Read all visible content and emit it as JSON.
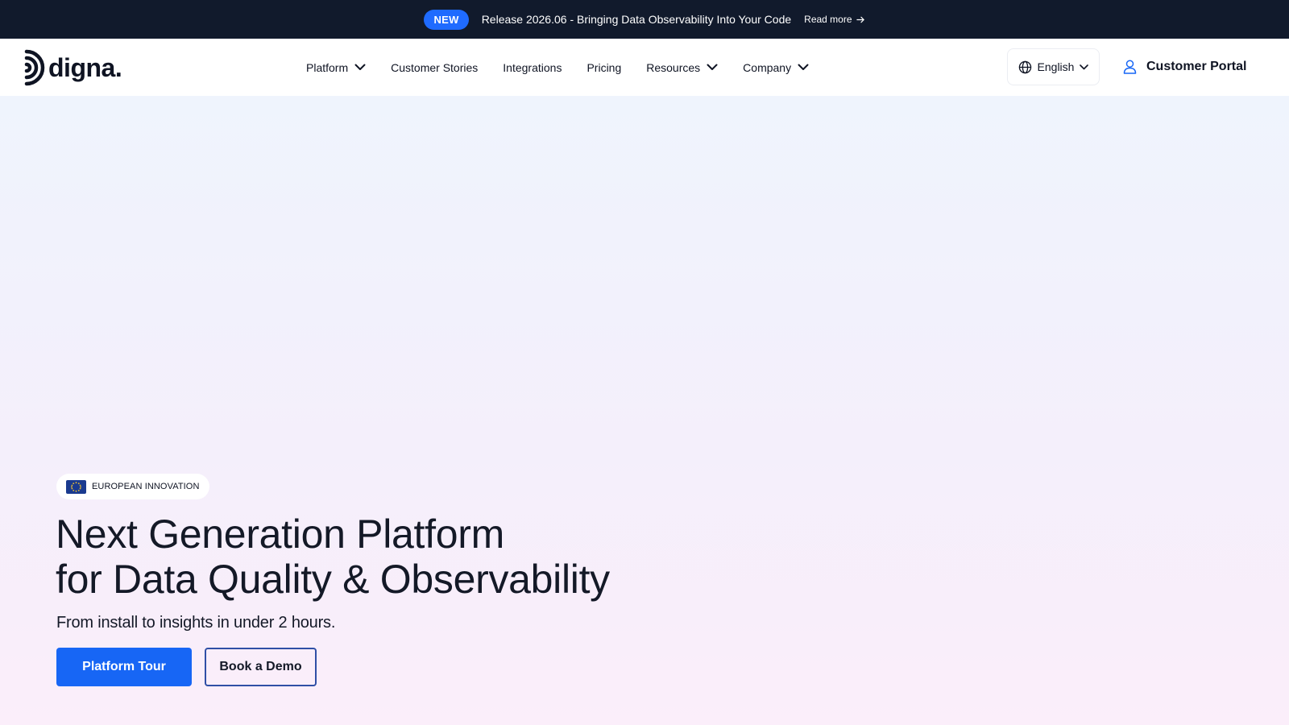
{
  "announcement": {
    "badge": "NEW",
    "message": "Release 2026.06 - Bringing Data Observability Into Your Code",
    "link_label": "Read more"
  },
  "nav": {
    "logo_text": "digna.",
    "items": [
      {
        "label": "Platform",
        "has_dropdown": true
      },
      {
        "label": "Customer Stories",
        "has_dropdown": false
      },
      {
        "label": "Integrations",
        "has_dropdown": false
      },
      {
        "label": "Pricing",
        "has_dropdown": false
      },
      {
        "label": "Resources",
        "has_dropdown": true
      },
      {
        "label": "Company",
        "has_dropdown": true
      }
    ],
    "language": "English",
    "portal_label": "Customer Portal"
  },
  "hero": {
    "badge": "EUROPEAN INNOVATION",
    "headline_line1": "Next Generation Platform",
    "headline_line2": "for Data Quality & Observability",
    "subheadline": "From install to insights in under 2 hours.",
    "primary_cta": "Platform Tour",
    "secondary_cta": "Book a Demo"
  },
  "colors": {
    "topbar_bg": "#111a2c",
    "accent_blue": "#1766f5",
    "badge_blue": "#1f6bff",
    "text_dark": "#141927",
    "outline_button": "#2f4fa6"
  },
  "icons": {
    "read_more": "arrow-right-icon",
    "dropdown": "chevron-down-icon",
    "language": "globe-icon",
    "portal": "user-icon",
    "badge": "eu-flag-icon"
  }
}
